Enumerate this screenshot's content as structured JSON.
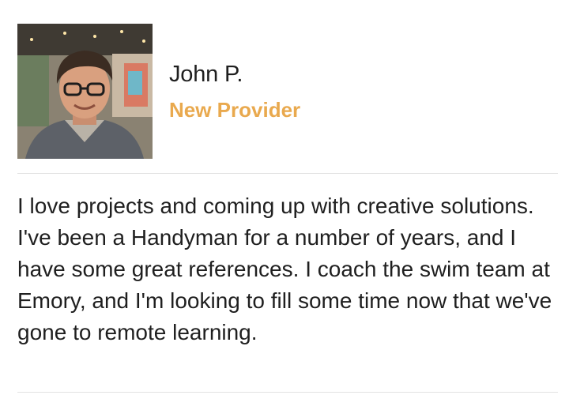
{
  "profile": {
    "name": "John P.",
    "badge": "New Provider",
    "bio": "I love projects and coming up with creative solutions. I've been a Handyman for a number of years, and I have some great references. I coach the swim team at Emory, and I'm looking to fill some time now that we've gone to remote learning."
  },
  "colors": {
    "badge": "#e9a94e",
    "text": "#1f1f1f",
    "divider": "#e2e2e2"
  }
}
